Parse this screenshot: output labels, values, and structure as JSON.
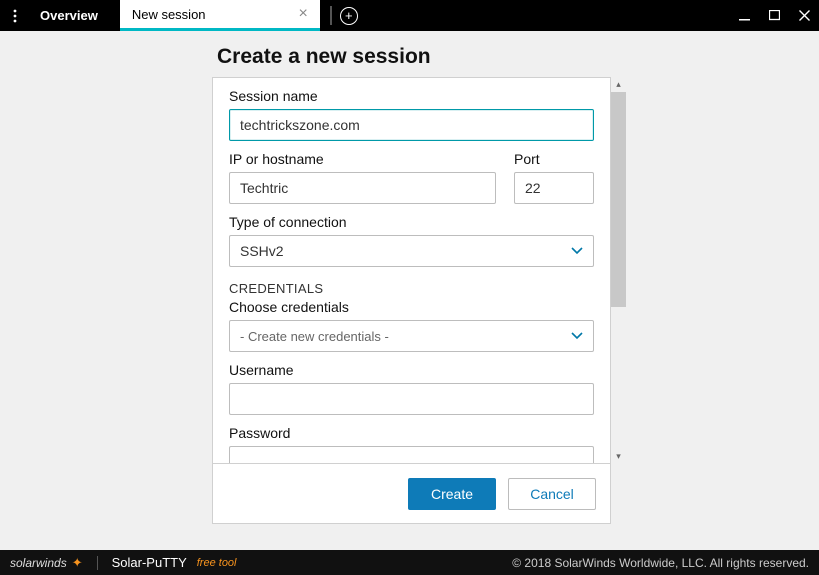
{
  "tabs": {
    "overview": "Overview",
    "new_session": "New session"
  },
  "heading": "Create a new session",
  "form": {
    "session_name_label": "Session name",
    "session_name_value": "techtrickszone.com",
    "ip_label": "IP or hostname",
    "ip_value": "Techtric",
    "port_label": "Port",
    "port_value": "22",
    "conn_type_label": "Type of connection",
    "conn_type_value": "SSHv2",
    "credentials_section": "CREDENTIALS",
    "choose_cred_label": "Choose credentials",
    "choose_cred_value": "- Create new credentials -",
    "username_label": "Username",
    "username_value": "",
    "password_label": "Password",
    "password_value": ""
  },
  "buttons": {
    "create": "Create",
    "cancel": "Cancel"
  },
  "footer": {
    "brand": "solarwinds",
    "product": "Solar-PuTTY",
    "freetool": "free tool",
    "copyright": "© 2018 SolarWinds Worldwide, LLC. All rights reserved."
  }
}
